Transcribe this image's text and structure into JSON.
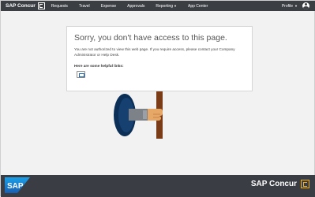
{
  "header": {
    "brand": "SAP Concur",
    "nav": [
      "Requests",
      "Travel",
      "Expense",
      "Approvals",
      "Reporting",
      "App Center"
    ],
    "profile_label": "Profile"
  },
  "card": {
    "title": "Sorry, you don't have access to this page.",
    "message": "You are not authorized to view this web page. If you require access, please contact your Company Administrator or Help Desk.",
    "helpful_links_label": "Here are some helpful links:"
  },
  "footer": {
    "sap_logo": "SAP",
    "brand": "SAP Concur"
  },
  "colors": {
    "header_bg": "#3b3f44",
    "footer_bg": "#3a3e44",
    "concur_accent": "#f5b21c",
    "sap_blue": "#1a73c9",
    "page_bg": "#f1f1f1"
  },
  "icons": [
    "concur-logo-icon",
    "caret-down-icon",
    "avatar-icon",
    "link-icon",
    "sap-logo-icon"
  ]
}
